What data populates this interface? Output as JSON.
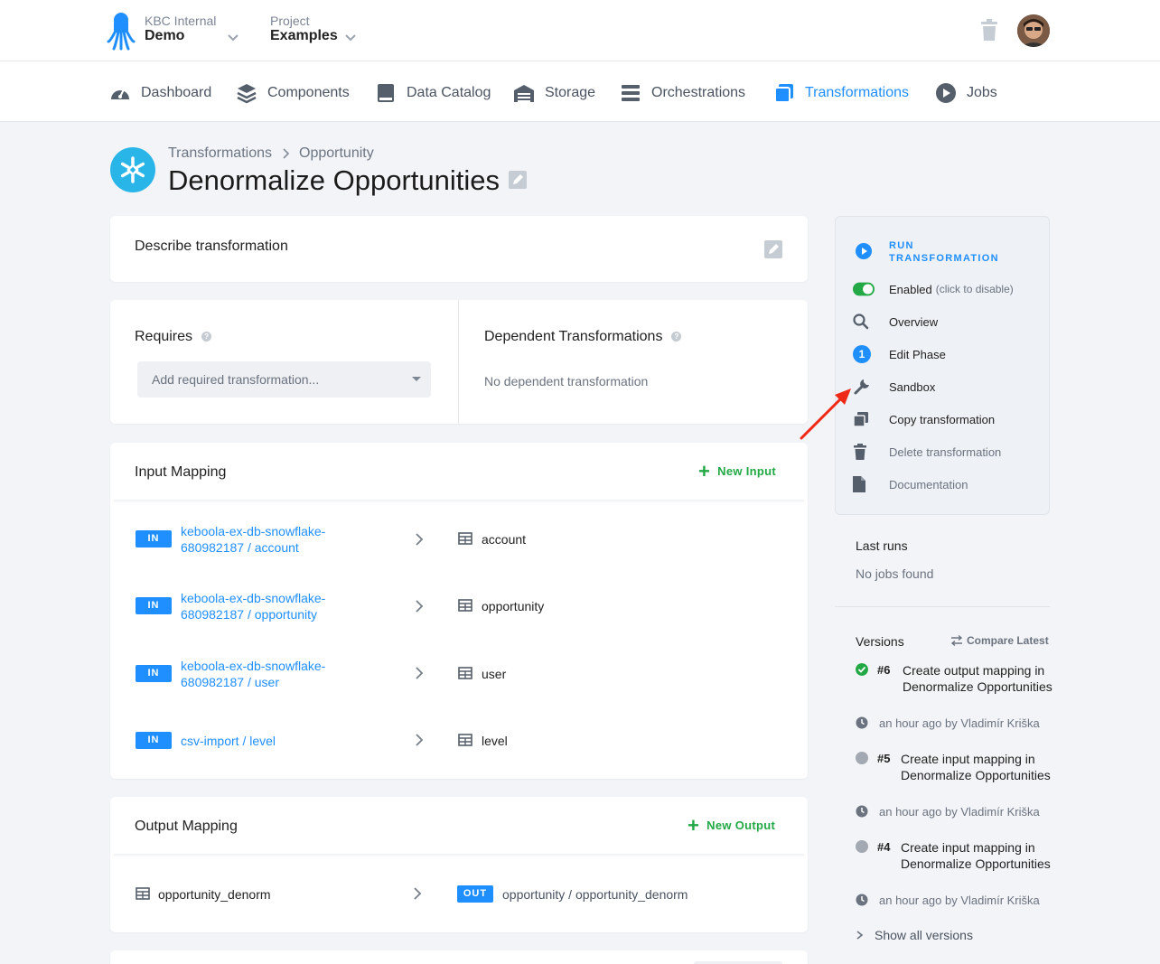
{
  "org": {
    "label": "KBC Internal",
    "value": "Demo"
  },
  "project": {
    "label": "Project",
    "value": "Examples"
  },
  "nav": {
    "dashboard": "Dashboard",
    "components": "Components",
    "data_catalog": "Data Catalog",
    "storage": "Storage",
    "orchestrations": "Orchestrations",
    "transformations": "Transformations",
    "jobs": "Jobs"
  },
  "breadcrumb": {
    "root": "Transformations",
    "current": "Opportunity"
  },
  "page_title": "Denormalize Opportunities",
  "describe": {
    "title": "Describe transformation"
  },
  "requires": {
    "title": "Requires",
    "placeholder": "Add required transformation..."
  },
  "dependent": {
    "title": "Dependent Transformations",
    "empty": "No dependent transformation"
  },
  "input_mapping": {
    "title": "Input Mapping",
    "new_label": "New Input",
    "rows": [
      {
        "badge": "IN",
        "source": "keboola-ex-db-snowflake-680982187 / account",
        "dest": "account"
      },
      {
        "badge": "IN",
        "source": "keboola-ex-db-snowflake-680982187 / opportunity",
        "dest": "opportunity"
      },
      {
        "badge": "IN",
        "source": "keboola-ex-db-snowflake-680982187 / user",
        "dest": "user"
      },
      {
        "badge": "IN",
        "source": "csv-import / level",
        "dest": "level"
      }
    ]
  },
  "output_mapping": {
    "title": "Output Mapping",
    "new_label": "New Output",
    "rows": [
      {
        "source": "opportunity_denorm",
        "badge": "OUT",
        "dest": "opportunity / opportunity_denorm"
      }
    ]
  },
  "sidebar": {
    "run": "RUN TRANSFORMATION",
    "enabled": "Enabled",
    "enabled_hint": "(click to disable)",
    "overview": "Overview",
    "edit_phase": "Edit Phase",
    "phase_number": "1",
    "sandbox": "Sandbox",
    "copy": "Copy transformation",
    "delete": "Delete transformation",
    "documentation": "Documentation"
  },
  "last_runs": {
    "title": "Last runs",
    "empty": "No jobs found"
  },
  "versions": {
    "title": "Versions",
    "compare": "Compare Latest",
    "items": [
      {
        "num": "#6",
        "desc": "Create output mapping in Denormalize Opportunities",
        "meta": "an hour ago by Vladimír Kriška",
        "status": "success"
      },
      {
        "num": "#5",
        "desc": "Create input mapping in Denormalize Opportunities",
        "meta": "an hour ago by Vladimír Kriška",
        "status": "neutral"
      },
      {
        "num": "#4",
        "desc": "Create input mapping in Denormalize Opportunities",
        "meta": "an hour ago by Vladimír Kriška",
        "status": "neutral"
      }
    ],
    "show_all": "Show all versions"
  },
  "colors": {
    "accent": "#1f8fff",
    "success": "#22a845",
    "annotation_arrow": "#ee2a16"
  }
}
